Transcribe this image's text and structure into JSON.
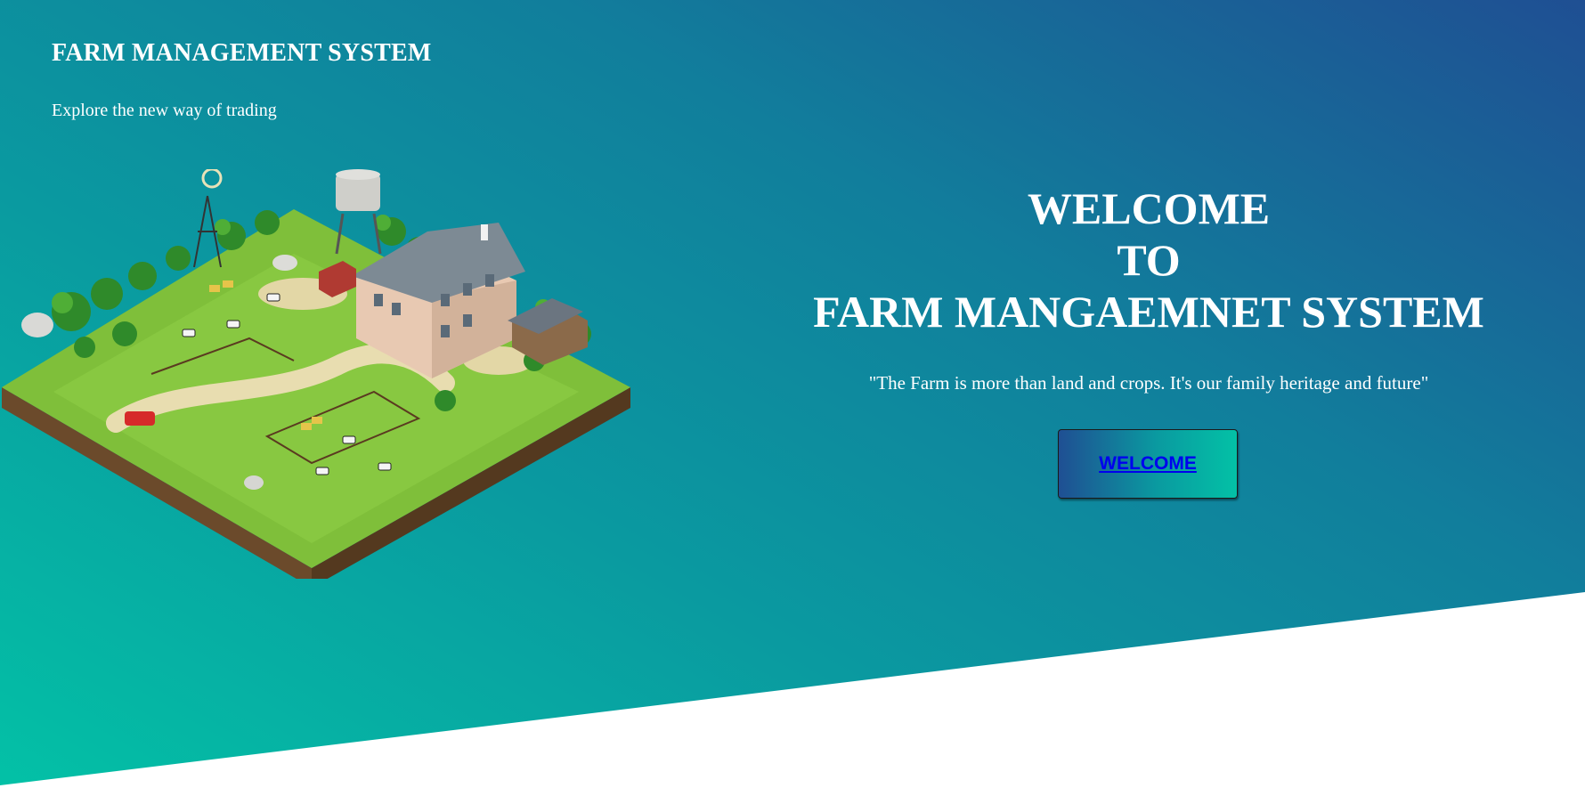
{
  "header": {
    "title": "FARM MANAGEMENT SYSTEM",
    "subtitle": "Explore the new way of trading"
  },
  "hero": {
    "illustration": "isometric-farm-illustration",
    "welcome_lines": [
      "WELCOME",
      "TO",
      "FARM MANGAEMNET SYSTEM"
    ],
    "quote": "\"The Farm is more than land and crops. It's our family heritage and future\"",
    "button_label": "WELCOME"
  },
  "colors": {
    "gradient_start": "#03c1a6",
    "gradient_end": "#1f4f93",
    "text": "#ffffff",
    "link": "#0000ee"
  }
}
